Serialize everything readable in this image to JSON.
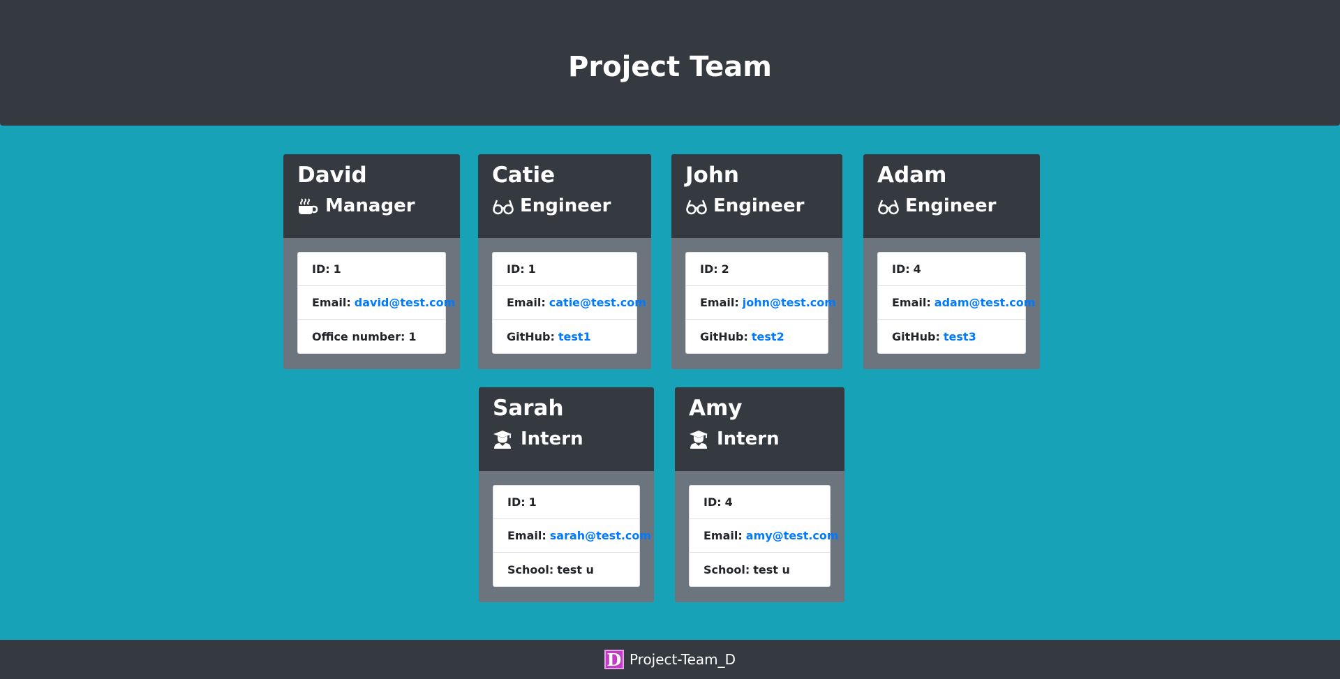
{
  "header": {
    "title": "Project Team"
  },
  "team": [
    {
      "name": "David",
      "role": "Manager",
      "role_icon": "coffee-icon",
      "id_label": "ID:",
      "id": "1",
      "email_label": "Email:",
      "email": "david@test.com",
      "extra_label": "Office number:",
      "extra": "1",
      "extra_is_link": false
    },
    {
      "name": "Catie",
      "role": "Engineer",
      "role_icon": "glasses-icon",
      "id_label": "ID:",
      "id": "1",
      "email_label": "Email:",
      "email": "catie@test.com",
      "extra_label": "GitHub:",
      "extra": "test1",
      "extra_is_link": true
    },
    {
      "name": "John",
      "role": "Engineer",
      "role_icon": "glasses-icon",
      "id_label": "ID:",
      "id": "2",
      "email_label": "Email:",
      "email": "john@test.com",
      "extra_label": "GitHub:",
      "extra": "test2",
      "extra_is_link": true
    },
    {
      "name": "Adam",
      "role": "Engineer",
      "role_icon": "glasses-icon",
      "id_label": "ID:",
      "id": "4",
      "email_label": "Email:",
      "email": "adam@test.com",
      "extra_label": "GitHub:",
      "extra": "test3",
      "extra_is_link": true
    },
    {
      "name": "Sarah",
      "role": "Intern",
      "role_icon": "graduate-icon",
      "id_label": "ID:",
      "id": "1",
      "email_label": "Email:",
      "email": "sarah@test.com",
      "extra_label": "School:",
      "extra": "test u",
      "extra_is_link": false
    },
    {
      "name": "Amy",
      "role": "Intern",
      "role_icon": "graduate-icon",
      "id_label": "ID:",
      "id": "4",
      "email_label": "Email:",
      "email": "amy@test.com",
      "extra_label": "School:",
      "extra": "test u",
      "extra_is_link": false
    }
  ],
  "footer": {
    "logo_letter": "D",
    "brand": "Project-Team_D"
  },
  "colors": {
    "background": "#17a2b8",
    "dark": "#343a40",
    "card_body": "#6c757d",
    "link": "#007bff"
  }
}
